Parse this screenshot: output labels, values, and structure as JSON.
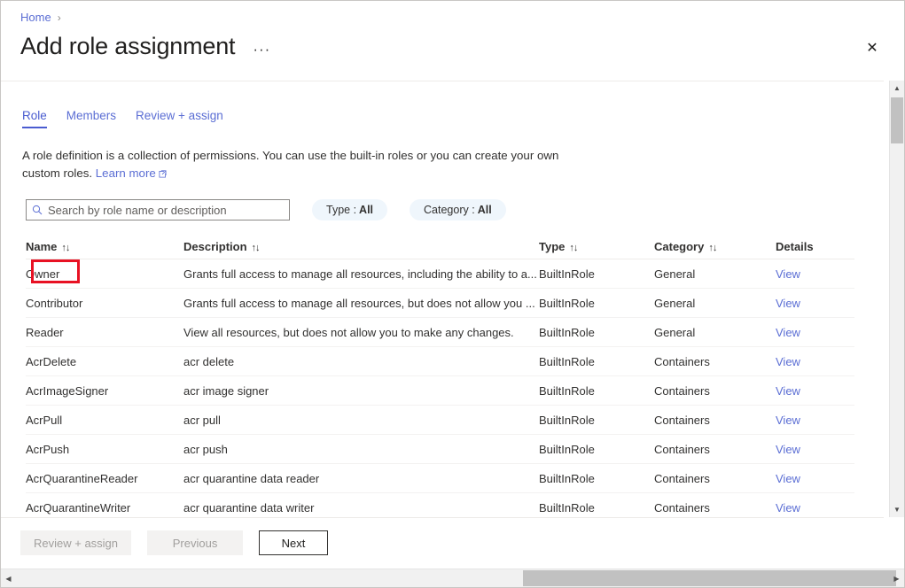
{
  "breadcrumb": {
    "home_label": "Home",
    "separator": "›"
  },
  "header": {
    "title": "Add role assignment",
    "more_menu": "···",
    "close_icon": "✕"
  },
  "tabs": [
    {
      "label": "Role",
      "active": true
    },
    {
      "label": "Members",
      "active": false
    },
    {
      "label": "Review + assign",
      "active": false
    }
  ],
  "description": {
    "text": "A role definition is a collection of permissions. You can use the built-in roles or you can create your own custom roles.",
    "link_label": "Learn more"
  },
  "search": {
    "placeholder": "Search by role name or description",
    "value": "",
    "icon": "search-icon"
  },
  "filters": [
    {
      "label": "Type :",
      "value": "All"
    },
    {
      "label": "Category :",
      "value": "All"
    }
  ],
  "table": {
    "columns": [
      {
        "label": "Name",
        "sortable": true
      },
      {
        "label": "Description",
        "sortable": true
      },
      {
        "label": "Type",
        "sortable": true
      },
      {
        "label": "Category",
        "sortable": true
      },
      {
        "label": "Details",
        "sortable": false
      }
    ],
    "sort_glyph": "↑↓",
    "details_link_label": "View",
    "rows": [
      {
        "name": "Owner",
        "description": "Grants full access to manage all resources, including the ability to a...",
        "type": "BuiltInRole",
        "category": "General",
        "details": "View",
        "highlighted": true
      },
      {
        "name": "Contributor",
        "description": "Grants full access to manage all resources, but does not allow you ...",
        "type": "BuiltInRole",
        "category": "General",
        "details": "View",
        "highlighted": false
      },
      {
        "name": "Reader",
        "description": "View all resources, but does not allow you to make any changes.",
        "type": "BuiltInRole",
        "category": "General",
        "details": "View",
        "highlighted": false
      },
      {
        "name": "AcrDelete",
        "description": "acr delete",
        "type": "BuiltInRole",
        "category": "Containers",
        "details": "View",
        "highlighted": false
      },
      {
        "name": "AcrImageSigner",
        "description": "acr image signer",
        "type": "BuiltInRole",
        "category": "Containers",
        "details": "View",
        "highlighted": false
      },
      {
        "name": "AcrPull",
        "description": "acr pull",
        "type": "BuiltInRole",
        "category": "Containers",
        "details": "View",
        "highlighted": false
      },
      {
        "name": "AcrPush",
        "description": "acr push",
        "type": "BuiltInRole",
        "category": "Containers",
        "details": "View",
        "highlighted": false
      },
      {
        "name": "AcrQuarantineReader",
        "description": "acr quarantine data reader",
        "type": "BuiltInRole",
        "category": "Containers",
        "details": "View",
        "highlighted": false
      },
      {
        "name": "AcrQuarantineWriter",
        "description": "acr quarantine data writer",
        "type": "BuiltInRole",
        "category": "Containers",
        "details": "View",
        "highlighted": false
      }
    ]
  },
  "footer": {
    "buttons": [
      {
        "label": "Review + assign",
        "state": "disabled"
      },
      {
        "label": "Previous",
        "state": "disabled"
      },
      {
        "label": "Next",
        "state": "default"
      }
    ]
  },
  "scrollbars": {
    "up_arrow": "▲",
    "down_arrow": "▼",
    "left_arrow": "◀",
    "right_arrow": "▶"
  },
  "colors": {
    "accent": "#5b6ed4",
    "highlight": "#e81123",
    "pill_bg": "#eff6fc"
  }
}
